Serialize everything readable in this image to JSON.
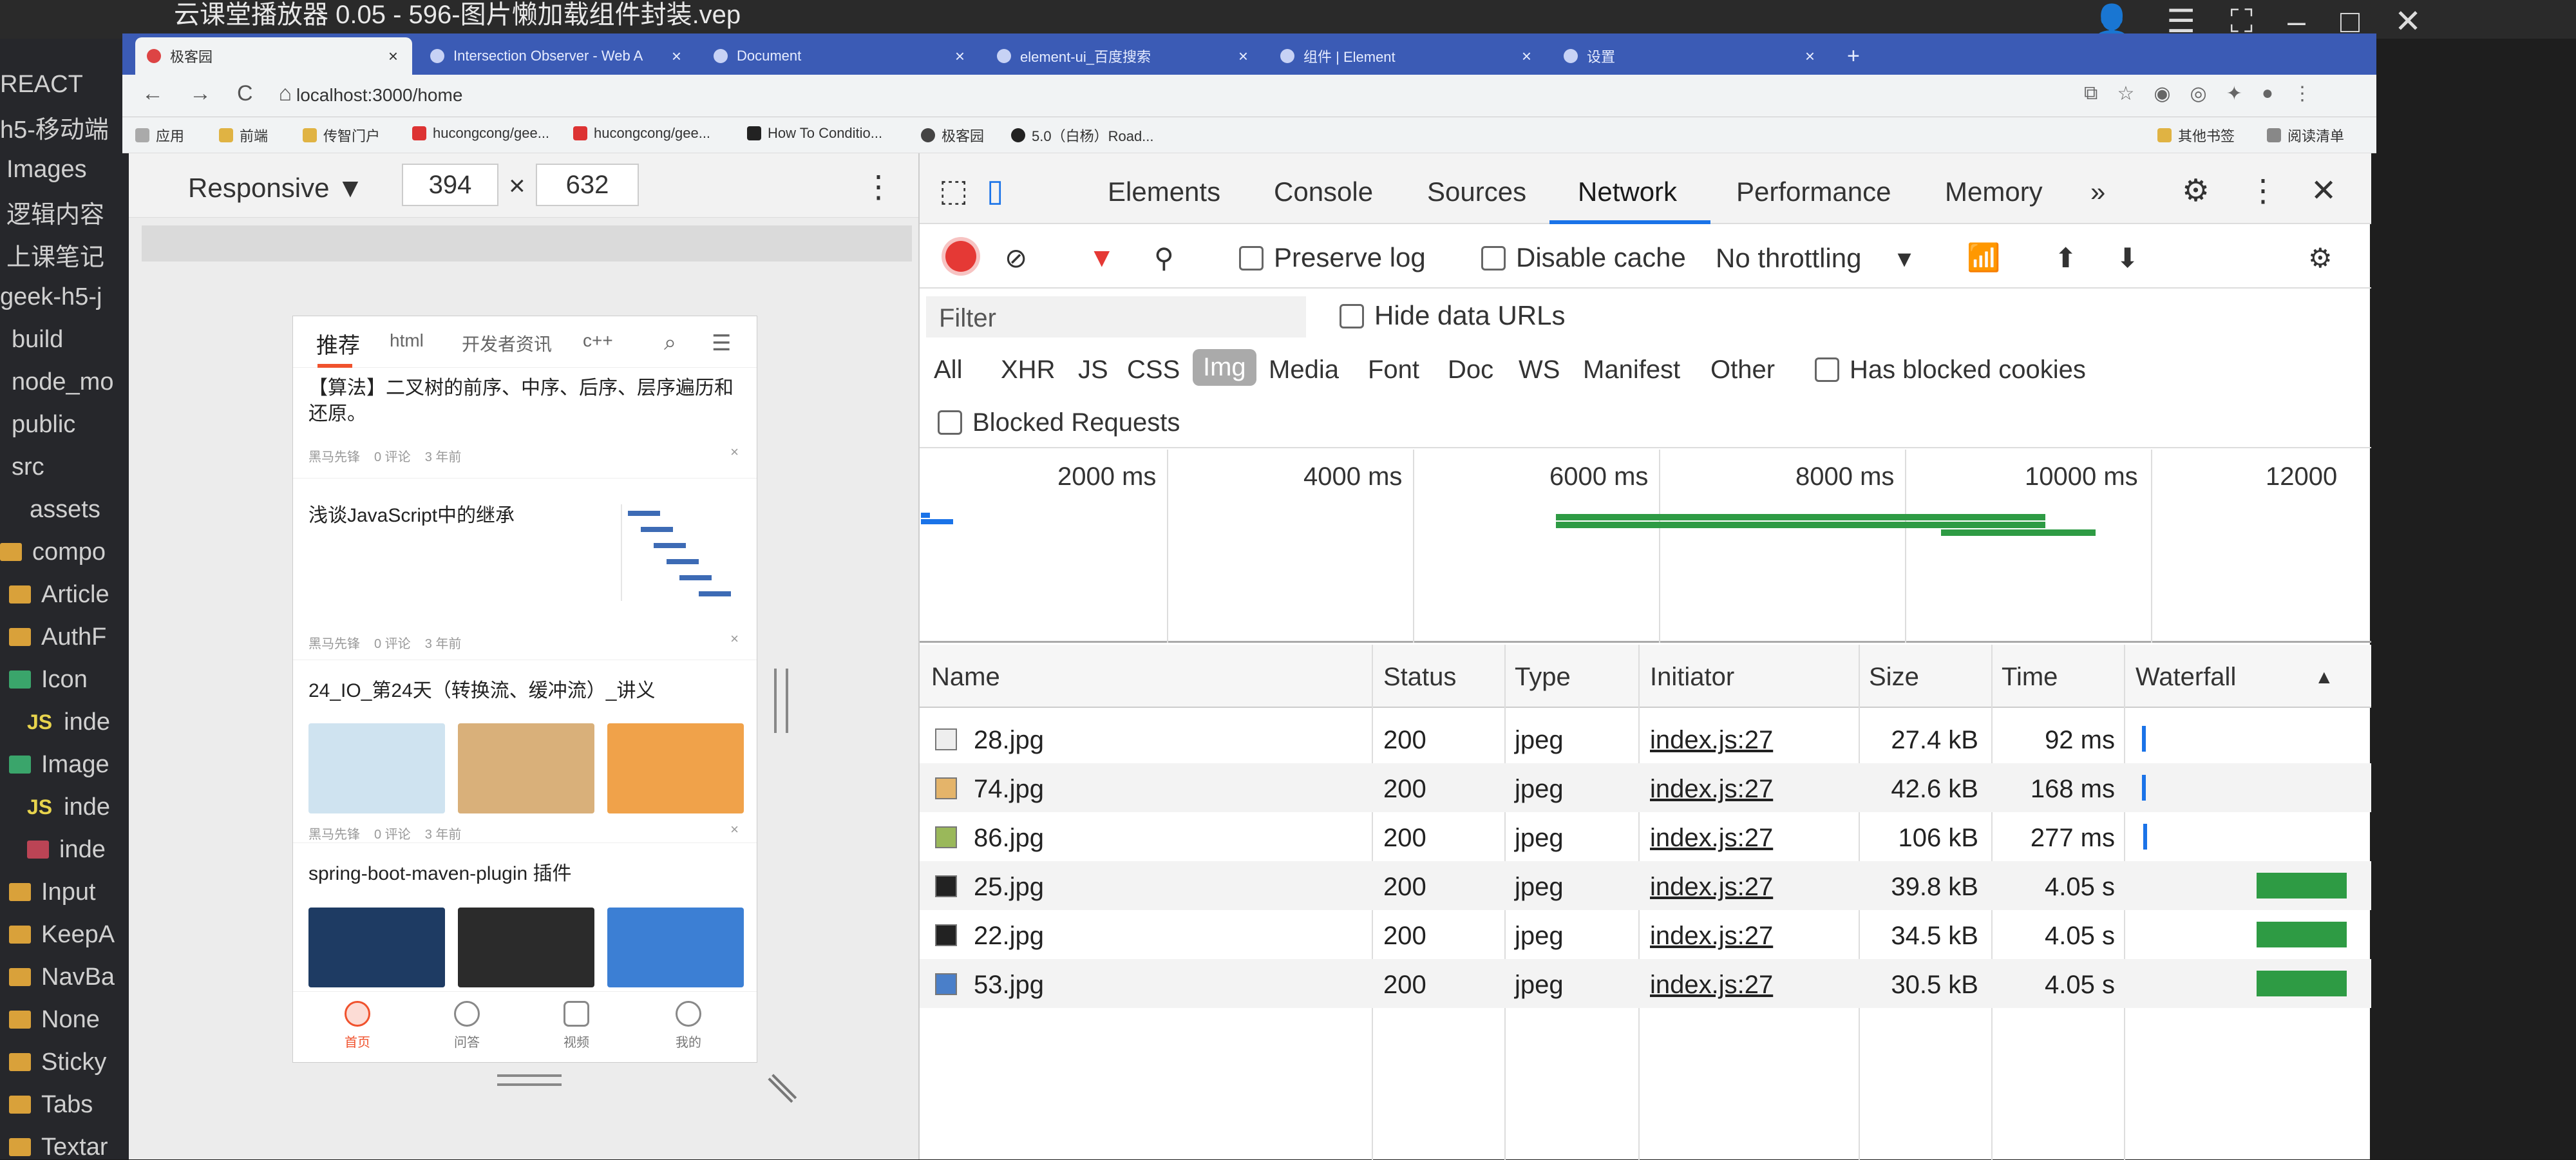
{
  "outer": {
    "title_text": "云课堂播放器 0.05 - 596-图片懒加载组件封装.vep",
    "left_sidebar": [
      "REACT",
      "h5-移动端",
      "Images",
      "逻辑内容",
      "上课笔记",
      "geek-h5-j",
      "build",
      "node_mo",
      "public",
      "src",
      "assets",
      "compo",
      "Article",
      "AuthF",
      "Icon",
      "inde",
      "Image",
      "inde",
      "inde",
      "Input",
      "KeepA",
      "NavBa",
      "None",
      "Sticky",
      "Tabs",
      "Textar"
    ]
  },
  "browser": {
    "tabs": [
      {
        "label": "极客园",
        "close": "×"
      },
      {
        "label": "Intersection Observer - Web A",
        "close": "×"
      },
      {
        "label": "Document",
        "close": "×"
      },
      {
        "label": "element-ui_百度搜索",
        "close": "×"
      },
      {
        "label": "组件 | Element",
        "close": "×"
      },
      {
        "label": "设置",
        "close": "×"
      }
    ],
    "new_tab": "+",
    "url": "localhost:3000/home",
    "bookmarks": [
      "应用",
      "前端",
      "传智门户",
      "hucongcong/gee...",
      "hucongcong/gee...",
      "How To Conditio...",
      "极客园",
      "5.0（白杨）Road..."
    ],
    "bookmarks_right": [
      "其他书签",
      "阅读清单"
    ],
    "nav": [
      "←",
      "→",
      "C",
      "⌂"
    ]
  },
  "emulator": {
    "device": "Responsive ▼",
    "width": "394",
    "height": "632",
    "times": "×",
    "more": "⋮"
  },
  "phone": {
    "tabs": [
      "推荐",
      "html",
      "开发者资讯",
      "c++"
    ],
    "articles": [
      {
        "title": "【算法】二叉树的前序、中序、后序、层序遍历和还原。",
        "author": "黑马先锋",
        "comments": "0 评论",
        "time": "3 年前"
      },
      {
        "title": "浅谈JavaScript中的继承",
        "author": "黑马先锋",
        "comments": "0 评论",
        "time": "3 年前"
      },
      {
        "title": "24_IO_第24天（转换流、缓冲流）_讲义",
        "author": "黑马先锋",
        "comments": "0 评论",
        "time": "3 年前"
      },
      {
        "title": "spring-boot-maven-plugin 插件",
        "author": "",
        "comments": "",
        "time": ""
      }
    ],
    "close": "×",
    "bottom_nav": [
      "首页",
      "问答",
      "视频",
      "我的"
    ]
  },
  "devtools": {
    "tabs": [
      "Elements",
      "Console",
      "Sources",
      "Network",
      "Performance",
      "Memory"
    ],
    "more_tabs": "»",
    "toolbar": {
      "preserve_log": "Preserve log",
      "disable_cache": "Disable cache",
      "throttling": "No throttling"
    },
    "filter_placeholder": "Filter",
    "hide_data_urls": "Hide data URLs",
    "types": [
      "All",
      "XHR",
      "JS",
      "CSS",
      "Img",
      "Media",
      "Font",
      "Doc",
      "WS",
      "Manifest",
      "Other"
    ],
    "has_blocked_cookies": "Has blocked cookies",
    "blocked_requests": "Blocked Requests",
    "timeline_ticks": [
      "2000 ms",
      "4000 ms",
      "6000 ms",
      "8000 ms",
      "10000 ms",
      "12000"
    ],
    "columns": [
      "Name",
      "Status",
      "Type",
      "Initiator",
      "Size",
      "Time",
      "Waterfall"
    ],
    "rows": [
      {
        "name": "28.jpg",
        "status": "200",
        "type": "jpeg",
        "initiator": "index.js:27",
        "size": "27.4 kB",
        "time": "92 ms"
      },
      {
        "name": "74.jpg",
        "status": "200",
        "type": "jpeg",
        "initiator": "index.js:27",
        "size": "42.6 kB",
        "time": "168 ms"
      },
      {
        "name": "86.jpg",
        "status": "200",
        "type": "jpeg",
        "initiator": "index.js:27",
        "size": "106 kB",
        "time": "277 ms"
      },
      {
        "name": "25.jpg",
        "status": "200",
        "type": "jpeg",
        "initiator": "index.js:27",
        "size": "39.8 kB",
        "time": "4.05 s"
      },
      {
        "name": "22.jpg",
        "status": "200",
        "type": "jpeg",
        "initiator": "index.js:27",
        "size": "34.5 kB",
        "time": "4.05 s"
      },
      {
        "name": "53.jpg",
        "status": "200",
        "type": "jpeg",
        "initiator": "index.js:27",
        "size": "30.5 kB",
        "time": "4.05 s"
      }
    ]
  },
  "colors": {
    "accent": "#1a73e8",
    "record": "#e53935",
    "waterfall_green": "#2e9b44",
    "brand": "#f0522d"
  }
}
